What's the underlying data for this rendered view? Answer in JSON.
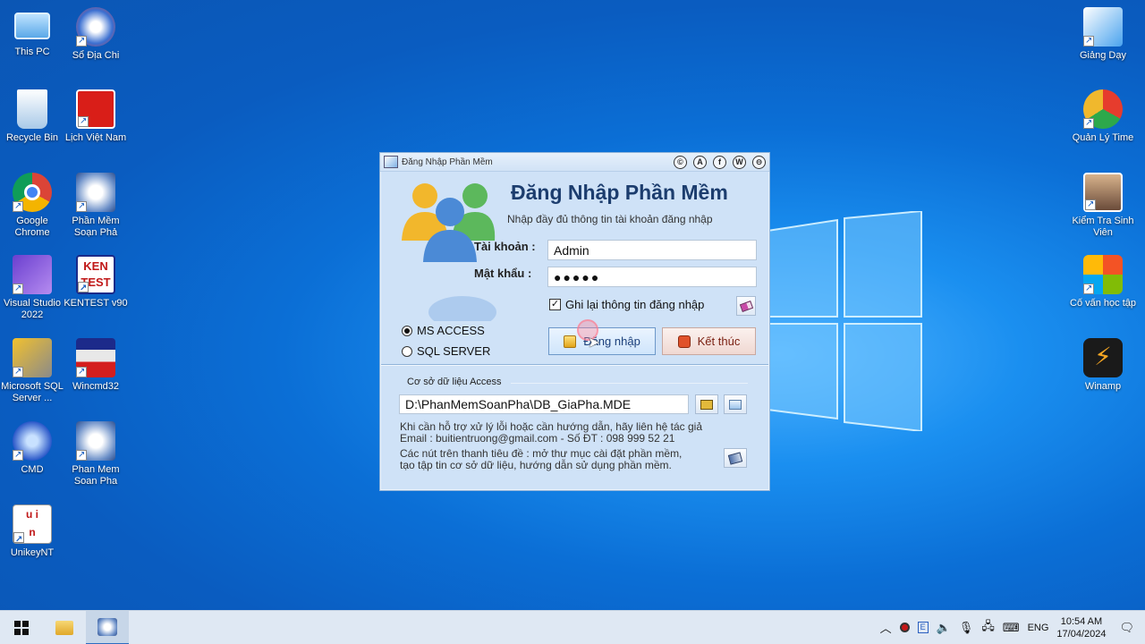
{
  "desktop": {
    "left_icons": [
      {
        "label": "This PC",
        "icon": "this-pc-icon"
      },
      {
        "label": "Sổ Địa Chi",
        "icon": "so-dia-chi-icon"
      },
      {
        "label": "Recycle Bin",
        "icon": "recycle-bin-icon"
      },
      {
        "label": "Lịch Việt Nam",
        "icon": "lich-viet-nam-icon"
      },
      {
        "label": "Google Chrome",
        "icon": "chrome-icon"
      },
      {
        "label": "Phần Mềm Soạn Phả",
        "icon": "phan-mem-soan-pha-icon"
      },
      {
        "label": "Visual Studio 2022",
        "icon": "visual-studio-icon"
      },
      {
        "label": "KENTEST v90",
        "icon": "kentest-icon"
      },
      {
        "label": "Microsoft SQL Server ...",
        "icon": "sql-server-icon"
      },
      {
        "label": "Wincmd32",
        "icon": "wincmd-icon"
      },
      {
        "label": "CMD",
        "icon": "cmd-icon"
      },
      {
        "label": "Phan Mem Soan Pha",
        "icon": "phan-mem-soan-pha-2-icon"
      },
      {
        "label": "UnikeyNT",
        "icon": "unikey-icon"
      }
    ],
    "right_icons": [
      {
        "label": "Giảng Dạy",
        "icon": "giang-day-icon"
      },
      {
        "label": "Quản Lý Time",
        "icon": "quan-ly-time-icon"
      },
      {
        "label": "Kiểm Tra Sinh Viên",
        "icon": "kiem-tra-sinh-vien-icon"
      },
      {
        "label": "Cố vấn học tập",
        "icon": "co-van-hoc-tap-icon"
      },
      {
        "label": "Winamp",
        "icon": "winamp-icon"
      }
    ]
  },
  "dialog": {
    "window_title": "Đăng Nhập Phần Mềm",
    "title_buttons": [
      "©",
      "A",
      "f",
      "W",
      "⊖"
    ],
    "heading": "Đăng Nhập Phần Mềm",
    "subheading": "Nhập đầy đủ thông tin tài khoản đăng nhập",
    "account_label": "Tài khoản :",
    "account_value": "Admin",
    "password_label": "Mật khẩu :",
    "password_value": "●●●●●",
    "remember_label": "Ghi lại thông tin đăng nhập",
    "remember_checked": true,
    "db_options": [
      {
        "label": "MS ACCESS",
        "selected": true
      },
      {
        "label": "SQL SERVER",
        "selected": false
      }
    ],
    "login_button": "Đăng nhập",
    "exit_button": "Kết thúc",
    "group_label": "Cơ sở dữ liệu Access",
    "db_path": "D:\\PhanMemSoanPha\\DB_GiaPha.MDE",
    "help_line1": "Khi cần hỗ trợ xử lý lỗi hoặc cần hướng dẫn, hãy liên hệ tác giả",
    "help_line2": "Email : buitientruong@gmail.com - Số ĐT : 098 999 52 21",
    "help_line3": "Các nút trên thanh tiêu đề : mở thư mục cài đặt phần mềm,",
    "help_line4": "tạo tập tin cơ sở dữ liệu, hướng dẫn sử dụng phần mềm."
  },
  "taskbar": {
    "language": "ENG",
    "time": "10:54 AM",
    "date": "17/04/2024"
  },
  "colors": {
    "desktop_blue": "#0b6fd6",
    "dialog_bg": "#cfe2f7",
    "heading": "#1c3d6e"
  }
}
